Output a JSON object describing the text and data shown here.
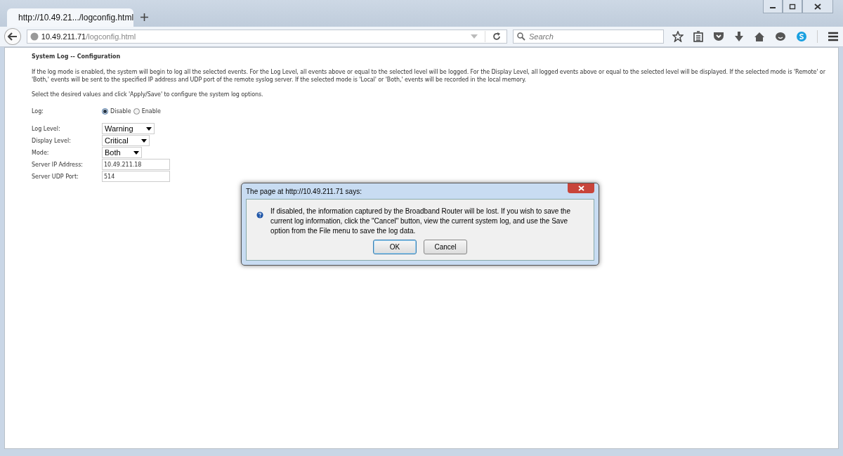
{
  "browser": {
    "tab_title": "http://10.49.21.../logconfig.html",
    "url_host": "10.49.211.71",
    "url_path": "/logconfig.html",
    "search": {
      "placeholder": "Search"
    }
  },
  "page": {
    "heading": "System Log -- Configuration",
    "intro": "If the log mode is enabled, the system will begin to log all the selected events. For the Log Level, all events above or equal to the selected level will be logged. For the Display Level, all logged events above or equal to the selected level will be displayed. If the selected mode is 'Remote' or 'Both,' events will be sent to the specified IP address and UDP port of the remote syslog server. If the selected mode is 'Local' or 'Both,' events will be recorded in the local memory.",
    "instruction": "Select the desired values and click 'Apply/Save' to configure the system log options.",
    "log": {
      "label": "Log:",
      "options": [
        {
          "label": "Disable",
          "selected": true
        },
        {
          "label": "Enable",
          "selected": false
        }
      ]
    },
    "fields": [
      {
        "kind": "select",
        "label": "Log Level:",
        "value": "Warning"
      },
      {
        "kind": "select",
        "label": "Display Level:",
        "value": "Critical"
      },
      {
        "kind": "select",
        "label": "Mode:",
        "value": "Both"
      },
      {
        "kind": "text",
        "label": "Server IP Address:",
        "value": "10.49.211.18"
      },
      {
        "kind": "text",
        "label": "Server UDP Port:",
        "value": "514"
      }
    ]
  },
  "dialog": {
    "title": "The page at http://10.49.211.71 says:",
    "message": "If disabled, the information captured by the Broadband Router will be lost. If you wish to save the current log information, click the \"Cancel\" button, view the current system log, and use the Save option from the File menu to save the log data.",
    "buttons": [
      {
        "label": "OK",
        "selected": true
      },
      {
        "label": "Cancel",
        "selected": false
      }
    ]
  }
}
